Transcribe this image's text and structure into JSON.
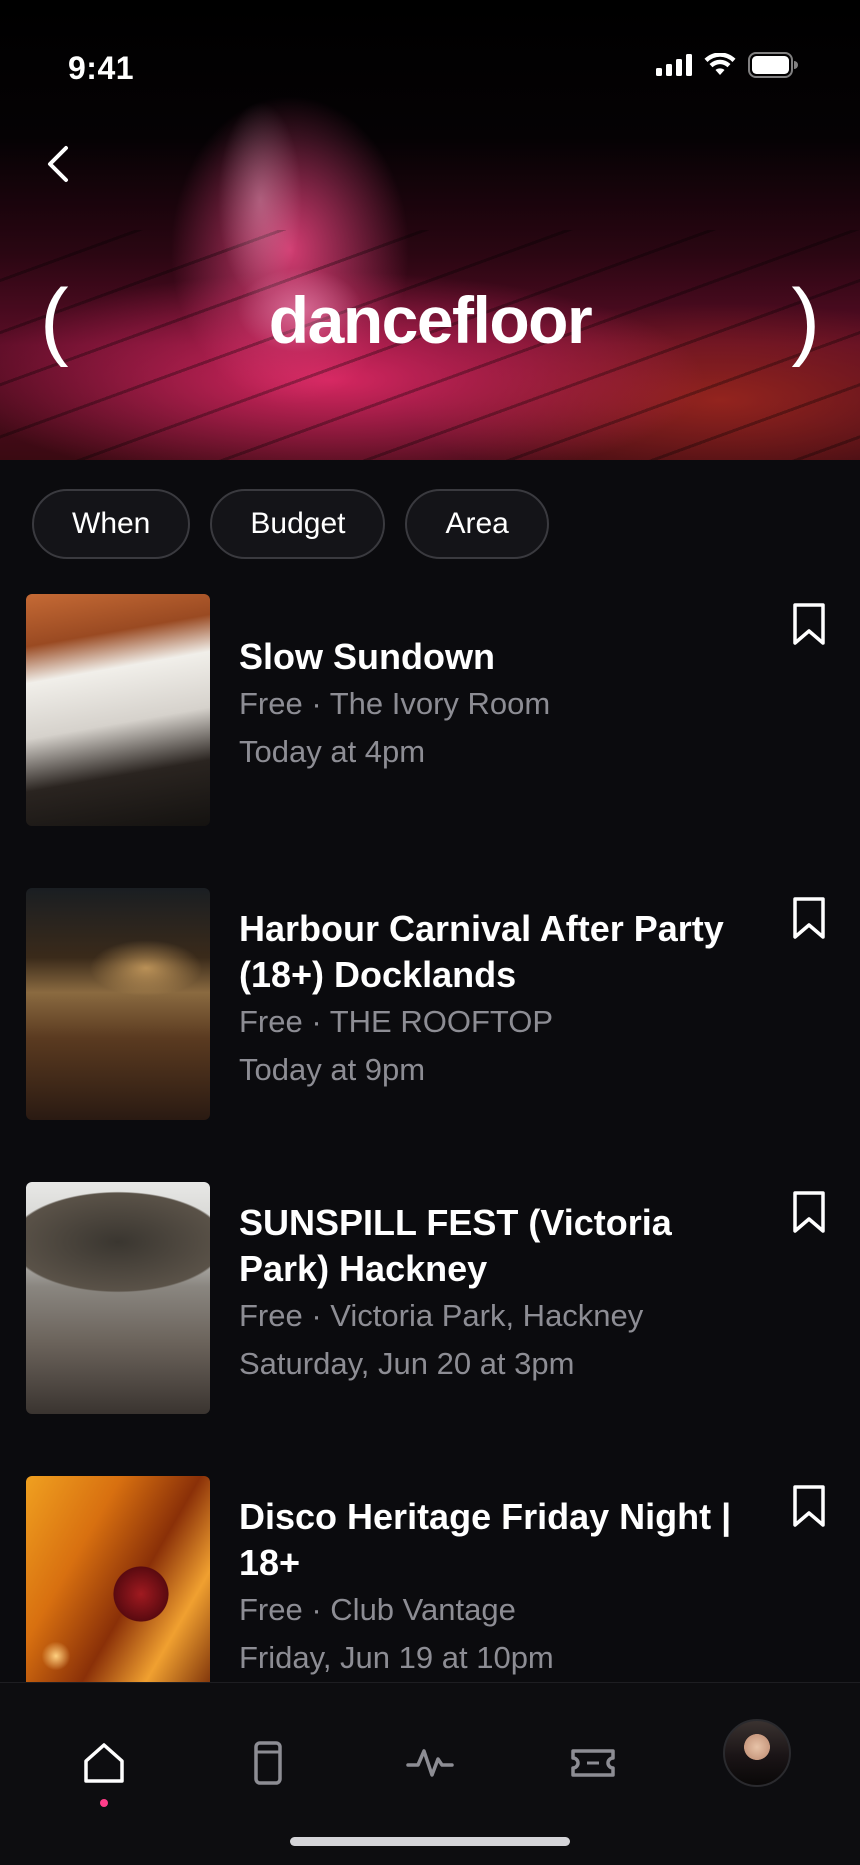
{
  "status_bar": {
    "time": "9:41"
  },
  "header": {
    "title": "dancefloor",
    "paren_open": "(",
    "paren_close": ")"
  },
  "filters": [
    {
      "label": "When"
    },
    {
      "label": "Budget"
    },
    {
      "label": "Area"
    }
  ],
  "events": [
    {
      "title": "Slow Sundown",
      "meta": "Free · The Ivory Room",
      "when": "Today at 4pm"
    },
    {
      "title": "Harbour Carnival After Party (18+) Docklands",
      "meta": "Free · THE ROOFTOP",
      "when": "Today at 9pm"
    },
    {
      "title": "SUNSPILL FEST (Victoria Park) Hackney",
      "meta": "Free · Victoria Park, Hackney",
      "when": "Saturday, Jun 20 at 3pm"
    },
    {
      "title": "Disco Heritage Friday Night | 18+",
      "meta": "Free · Club Vantage",
      "when": "Friday, Jun 19 at 10pm"
    }
  ],
  "tab_bar": {
    "active": "home",
    "tabs": [
      "home-icon",
      "phone-icon",
      "activity-icon",
      "ticket-icon",
      "profile-avatar"
    ],
    "accent": "#ff3d8a"
  }
}
